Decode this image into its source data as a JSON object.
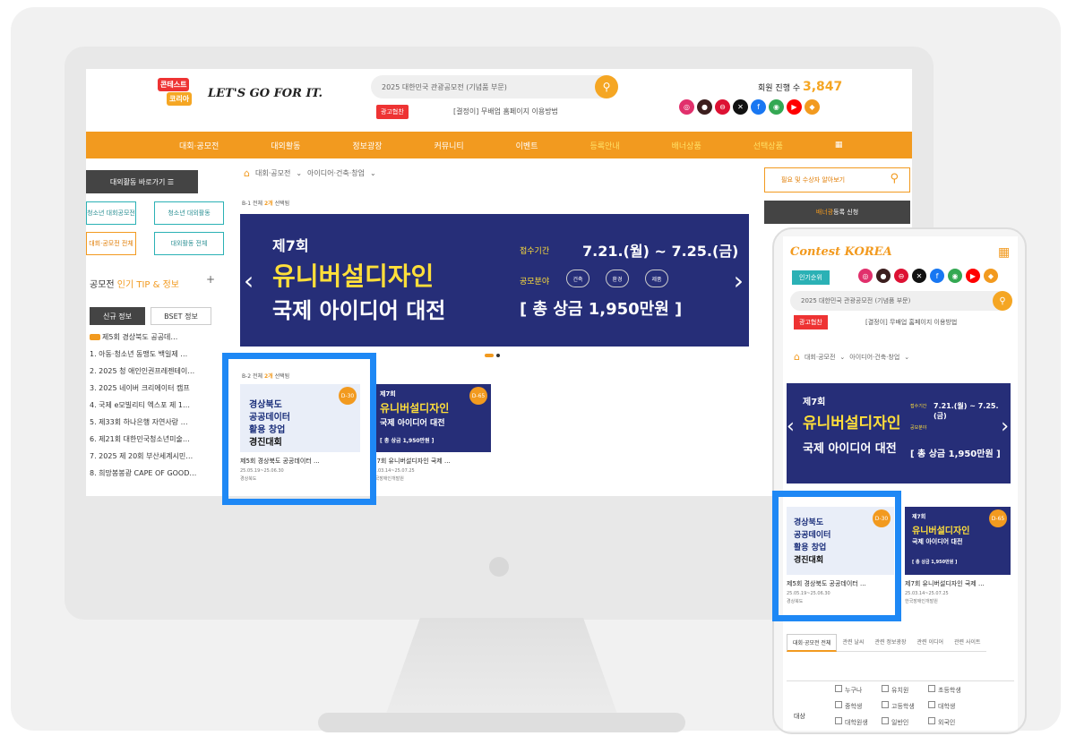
{
  "brand": {
    "logo_top": "콘테스트",
    "logo_bottom": "코리아",
    "slogan": "LET'S GO FOR IT.",
    "mobile_logo": "Contest KOREA"
  },
  "header": {
    "search_placeholder": "2025 대한민국 관광공모전 (기념품 부문)",
    "ad_badge": "광고협찬",
    "ad_text": "[결정이] 무배업 홈페이지 이용방법",
    "counter_label": "회원 진행 수",
    "counter_value": "3,847"
  },
  "socials": [
    {
      "icon": "instagram-icon",
      "color": "#e1306c"
    },
    {
      "icon": "kakao-icon",
      "color": "#3c1e1e"
    },
    {
      "icon": "chat-icon",
      "color": "#d13"
    },
    {
      "icon": "x-icon",
      "color": "#111"
    },
    {
      "icon": "facebook-icon",
      "color": "#1877f2"
    },
    {
      "icon": "chrome-icon",
      "color": "#34a853"
    },
    {
      "icon": "youtube-icon",
      "color": "#f00"
    },
    {
      "icon": "app-icon",
      "color": "#f29a1f"
    }
  ],
  "nav": [
    "대회·공모전",
    "대외활동",
    "정보광장",
    "커뮤니티",
    "이벤트",
    "등록안내",
    "배너상품",
    "선택상품"
  ],
  "sidebar": {
    "shortcut": "대외활동 바로가기 ☰",
    "categories": [
      "청소년 대회공모전",
      "청소년 대외활동",
      "대회·공모전 전체",
      "대외활동 전체"
    ],
    "tip_title_a": "공모전 ",
    "tip_title_b": "인기 TIP & 정보",
    "tab_new": "신규 정보",
    "tab_best": "BSET 정보",
    "tips": [
      "제5회 경상북도 공공데…",
      "1. 아동·청소년 동맹도 백일제 …",
      "2. 2025 청 애인인권프레젠테이…",
      "3. 2025 네이버 크리에이터 캠프",
      "4. 국제 e모빌리티 엑스포 제 1…",
      "5. 제33회 하나은행 자연사랑 …",
      "6. 제21회 대한민국청소년미술…",
      "7. 2025 제 20회 부산세계시민…",
      "8. 희망봉봉광 CAPE OF GOOD…"
    ]
  },
  "crumb": {
    "a": "대회·공모전",
    "b": "아이디어·건축·창업"
  },
  "section1": {
    "prefix": "B-1 전체 ",
    "count": "2개",
    "suffix": " 선택됨"
  },
  "banner": {
    "round": "제7회",
    "title1": "유니버설디자인",
    "title2": "국제 아이디어 대전",
    "period_label": "접수기간",
    "period": "7.21.(월) ~ 7.25.(금)",
    "field_label": "공모분야",
    "fields": [
      "건축",
      "환경",
      "제품"
    ],
    "prize": "[ 총 상금 1,950만원 ]"
  },
  "section2": {
    "prefix": "B-2 전체 ",
    "count": "2개",
    "suffix": " 선택됨"
  },
  "cards": [
    {
      "dday": "D-30",
      "lines": [
        "경상북도",
        "공공데이터",
        "활용 창업",
        "경진대회"
      ],
      "title": "제5회 경상북도 공공데이터 ...",
      "date": "25.05.19~25.06.30",
      "org": "경상북도"
    },
    {
      "dday": "D-65",
      "lines": [
        "제7회",
        "유니버설디자인",
        "국제 아이디어 대전",
        "[ 총 상금 1,950만원 ]"
      ],
      "title": "제7회 유니버설디자인 국제 ...",
      "date": "25.03.14~25.07.25",
      "org": "한국장애인개발원"
    }
  ],
  "right": {
    "search": "필요 및 수상자 알아보기",
    "register_a": "배너광",
    "register_b": " 등록 신청"
  },
  "mobile": {
    "rank": "인기순위",
    "tabs": [
      "대회·공모전 전체",
      "관련 날씨",
      "관련 정보광장",
      "관련 이디어",
      "관련 사이트"
    ],
    "filter_label": "대상",
    "filter_options": [
      "누구나",
      "유치원",
      "초등학생",
      "중학생",
      "고등학생",
      "대학생",
      "대학원생",
      "일반인",
      "외국인"
    ]
  }
}
